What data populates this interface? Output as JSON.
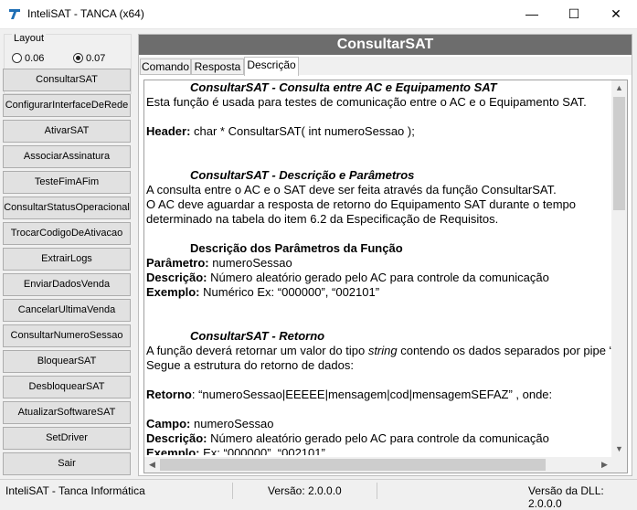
{
  "window": {
    "title": "InteliSAT - TANCA (x64)",
    "minimize": "—",
    "maximize": "☐",
    "close": "✕"
  },
  "layout": {
    "label": "Layout",
    "options": [
      "0.06",
      "0.07"
    ],
    "selected": "0.07"
  },
  "sidebar": {
    "buttons": [
      "ConsultarSAT",
      "ConfigurarInterfaceDeRede",
      "AtivarSAT",
      "AssociarAssinatura",
      "TesteFimAFim",
      "ConsultarStatusOperacional",
      "TrocarCodigoDeAtivacao",
      "ExtrairLogs",
      "EnviarDadosVenda",
      "CancelarUltimaVenda",
      "ConsultarNumeroSessao",
      "BloquearSAT",
      "DesbloquearSAT",
      "AtualizarSoftwareSAT",
      "SetDriver",
      "Sair"
    ]
  },
  "panel": {
    "title": "ConsultarSAT",
    "tabs": [
      "Comando",
      "Resposta",
      "Descrição"
    ],
    "active_tab": "Descrição"
  },
  "doc": {
    "h1": "ConsultarSAT - Consulta entre AC e Equipamento SAT",
    "intro": "Esta função é usada para testes de comunicação entre o AC e o Equipamento SAT.",
    "header_label": "Header:",
    "header_value": " char * ConsultarSAT( int numeroSessao );",
    "h2": "ConsultarSAT - Descrição e Parâmetros",
    "desc1": "A consulta entre o AC e o SAT deve ser feita através da função ConsultarSAT.",
    "desc2": "O AC deve aguardar a resposta de retorno do Equipamento SAT durante o tempo",
    "desc3": "determinado na tabela do item 6.2 da Especificação de Requisitos.",
    "h3": "Descrição dos Parâmetros da Função",
    "param_label": "Parâmetro:",
    "param_value": " numeroSessao",
    "descr_label": "Descrição:",
    "descr_value": " Número aleatório gerado pelo AC para controle da comunicação",
    "ex_label": "Exemplo:",
    "ex_value": " Numérico Ex: “000000”, “002101”",
    "h4": "ConsultarSAT - Retorno",
    "ret1_a": "A função deverá retornar um valor do tipo ",
    "ret1_b": "string",
    "ret1_c": " contendo os dados separados por pipe “|",
    "ret2": "Segue a estrutura do retorno de dados:",
    "ret_label": "Retorno",
    "ret_value": ": “numeroSessao|EEEEE|mensagem|cod|mensagemSEFAZ” , onde:",
    "campo_label": "Campo:",
    "campo_value": " numeroSessao",
    "descr2_label": "Descrição:",
    "descr2_value": " Número aleatório gerado pelo AC para controle da comunicação",
    "ex2_label": "Exemplo:",
    "ex2_value": " Ex: “000000”, “002101”"
  },
  "status": {
    "app": "InteliSAT - Tanca Informática",
    "version": "Versão: 2.0.0.0",
    "dll_version": "Versão da DLL: 2.0.0.0"
  },
  "colors": {
    "header_bg": "#6d6d6d",
    "app_icon": "#1f6fb5"
  }
}
